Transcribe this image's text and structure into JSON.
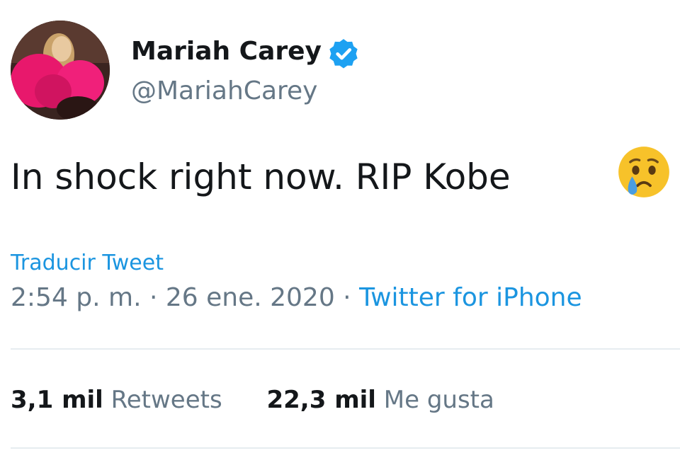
{
  "user": {
    "display_name": "Mariah Carey",
    "handle": "@MariahCarey",
    "verified": true
  },
  "tweet": {
    "text": "In shock right now. RIP Kobe",
    "emoji": "crying-face",
    "translate_label": "Traducir Tweet",
    "timestamp": "2:54 p. m. · 26 ene. 2020",
    "separator": " · ",
    "source": "Twitter for iPhone"
  },
  "stats": {
    "retweets_count": "3,1 mil",
    "retweets_label": "Retweets",
    "likes_count": "22,3 mil",
    "likes_label": "Me gusta"
  },
  "colors": {
    "link": "#1b95e0",
    "text": "#14171a",
    "secondary": "#657786",
    "verified_badge": "#1da1f2"
  }
}
